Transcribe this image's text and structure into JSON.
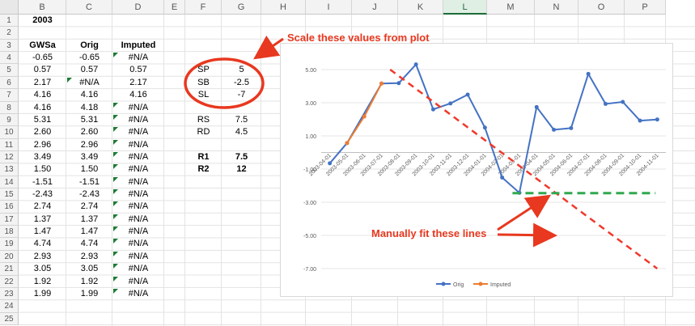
{
  "columns": [
    "B",
    "C",
    "D",
    "E",
    "F",
    "G",
    "H",
    "I",
    "J",
    "K",
    "L",
    "M",
    "N",
    "O",
    "P"
  ],
  "selected_column": "L",
  "rows": [
    "1",
    "2",
    "3",
    "4",
    "5",
    "6",
    "7",
    "8",
    "9",
    "10",
    "11",
    "12",
    "13",
    "14",
    "15",
    "16",
    "17",
    "18",
    "19",
    "20",
    "21",
    "22",
    "23",
    "24",
    "25"
  ],
  "year_label": "2003",
  "table_headers": {
    "gwsa": "GWSa",
    "orig": "Orig",
    "imputed": "Imputed"
  },
  "table_rows": [
    [
      "-0.65",
      "-0.65",
      "#N/A"
    ],
    [
      "0.57",
      "0.57",
      "0.57"
    ],
    [
      "2.17",
      "#N/A",
      "2.17"
    ],
    [
      "4.16",
      "4.16",
      "4.16"
    ],
    [
      "4.16",
      "4.18",
      "#N/A"
    ],
    [
      "5.31",
      "5.31",
      "#N/A"
    ],
    [
      "2.60",
      "2.60",
      "#N/A"
    ],
    [
      "2.96",
      "2.96",
      "#N/A"
    ],
    [
      "3.49",
      "3.49",
      "#N/A"
    ],
    [
      "1.50",
      "1.50",
      "#N/A"
    ],
    [
      "-1.51",
      "-1.51",
      "#N/A"
    ],
    [
      "-2.43",
      "-2.43",
      "#N/A"
    ],
    [
      "2.74",
      "2.74",
      "#N/A"
    ],
    [
      "1.37",
      "1.37",
      "#N/A"
    ],
    [
      "1.47",
      "1.47",
      "#N/A"
    ],
    [
      "4.74",
      "4.74",
      "#N/A"
    ],
    [
      "2.93",
      "2.93",
      "#N/A"
    ],
    [
      "3.05",
      "3.05",
      "#N/A"
    ],
    [
      "1.92",
      "1.92",
      "#N/A"
    ],
    [
      "1.99",
      "1.99",
      "#N/A"
    ]
  ],
  "params": [
    {
      "label": "SP",
      "value": "5",
      "bold": false
    },
    {
      "label": "SB",
      "value": "-2.5",
      "bold": false
    },
    {
      "label": "SL",
      "value": "-7",
      "bold": false
    },
    {
      "label": "RS",
      "value": "7.5",
      "bold": false
    },
    {
      "label": "RD",
      "value": "4.5",
      "bold": false
    },
    {
      "label": "R1",
      "value": "7.5",
      "bold": true
    },
    {
      "label": "R2",
      "value": "12",
      "bold": true
    }
  ],
  "annotations": {
    "scale": "Scale these values from plot",
    "fit": "Manually fit these lines"
  },
  "colors": {
    "orig": "#4472c4",
    "imputed": "#ed7d31",
    "annotation": "#e8381f",
    "fit_down": "#f0392b",
    "fit_flat": "#2fa84f",
    "check": "#1e7b34"
  },
  "chart_data": {
    "type": "line",
    "categories": [
      "2003-04-01",
      "2003-05-01",
      "2003-06-01",
      "2003-07-01",
      "2003-08-01",
      "2003-09-01",
      "2003-10-01",
      "2003-11-01",
      "2003-12-01",
      "2004-01-01",
      "2004-02-01",
      "2004-03-01",
      "2004-04-01",
      "2004-05-01",
      "2004-06-01",
      "2004-07-01",
      "2004-08-01",
      "2004-09-01",
      "2004-10-01",
      "2004-11-01"
    ],
    "series": [
      {
        "name": "Orig",
        "values": [
          -0.65,
          0.57,
          null,
          4.16,
          4.18,
          5.31,
          2.6,
          2.96,
          3.49,
          1.5,
          -1.51,
          -2.43,
          2.74,
          1.37,
          1.47,
          4.74,
          2.93,
          3.05,
          1.92,
          1.99
        ]
      },
      {
        "name": "Imputed",
        "values": [
          null,
          0.57,
          2.17,
          4.16,
          null,
          null,
          null,
          null,
          null,
          null,
          null,
          null,
          null,
          null,
          null,
          null,
          null,
          null,
          null,
          null
        ]
      }
    ],
    "y_ticks": [
      "5.00",
      "3.00",
      "1.00",
      "-1.00",
      "-3.00",
      "-5.00",
      "-7.00"
    ],
    "ylim": [
      -7,
      5
    ],
    "fit_lines": [
      {
        "style": "dashed",
        "x": [
          4,
          19.5
        ],
        "y": [
          5,
          -7
        ]
      },
      {
        "style": "dashed",
        "x": [
          11.1,
          19.4
        ],
        "y": [
          -2.45,
          -2.45
        ]
      }
    ],
    "legend_position": "bottom"
  }
}
